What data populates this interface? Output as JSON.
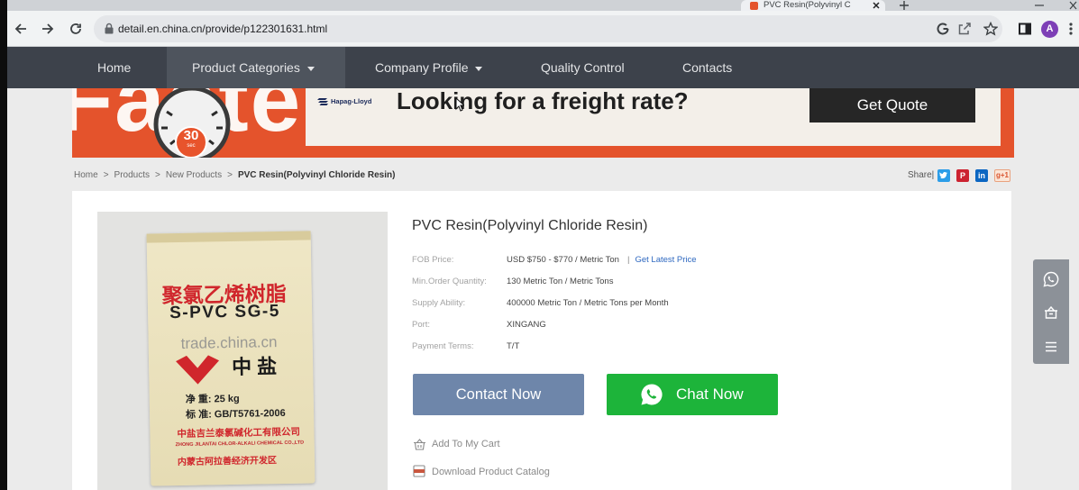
{
  "browser": {
    "tab_title": "PVC Resin(Polyvinyl C",
    "url": "detail.en.china.cn/provide/p122301631.html",
    "avatar_letter": "A"
  },
  "nav": {
    "items": [
      {
        "label": "Home"
      },
      {
        "label": "Product Categories",
        "has_dropdown": true,
        "active": true
      },
      {
        "label": "Company Profile",
        "has_dropdown": true
      },
      {
        "label": "Quality Control"
      },
      {
        "label": "Contacts"
      }
    ]
  },
  "banner": {
    "headline_fragment": "Faster",
    "timer_number": "30",
    "timer_unit": "sec",
    "brand": "Hapag-Lloyd",
    "headline": "Looking for a freight rate?",
    "cta": "Get Quote"
  },
  "breadcrumb": {
    "separator": ">",
    "items": [
      "Home",
      "Products",
      "New Products"
    ],
    "current": "PVC Resin(Polyvinyl Chloride Resin)"
  },
  "share": {
    "label": "Share|",
    "pinterest_logo": "P",
    "linkedin_logo": "in",
    "gplus_logo": "g+1"
  },
  "product": {
    "title": "PVC Resin(Polyvinyl Chloride Resin)",
    "specs": [
      {
        "label": "FOB Price:",
        "value": "USD $750 - $770 / Metric Ton"
      },
      {
        "label": "Min.Order Quantity:",
        "value": "130 Metric Ton / Metric Tons"
      },
      {
        "label": "Supply Ability:",
        "value": "400000 Metric Ton / Metric Tons per Month"
      },
      {
        "label": "Port:",
        "value": "XINGANG"
      },
      {
        "label": "Payment Terms:",
        "value": "T/T"
      }
    ],
    "price_separator": "|",
    "price_link": "Get Latest Price",
    "contact_button": "Contact Now",
    "chat_button": "Chat Now",
    "add_to_cart": "Add To My Cart",
    "download_catalog": "Download Product Catalog",
    "image": {
      "name_cn": "聚氯乙烯树脂",
      "grade": "S-PVC SG-5",
      "watermark": "trade.china.cn",
      "brand_cn": "中盐",
      "net_weight": "净 重: 25 kg",
      "standard": "标 准: GB/T5761-2006",
      "company_cn": "中盐吉兰泰氯碱化工有限公司",
      "company_en": "ZHONG JILANTAI CHLOR-ALKALI CHEMICAL CO.,LTD",
      "address_cn": "内蒙古阿拉善经济开发区"
    }
  },
  "icons": {
    "browser": [
      "arrow-left-icon",
      "arrow-right-icon",
      "reload-icon",
      "lock-icon",
      "google-icon",
      "share-icon",
      "star-icon",
      "side-panel-icon",
      "menu-dots-icon"
    ],
    "share": [
      "twitter-icon",
      "pinterest-icon",
      "linkedin-icon",
      "google-plus-icon"
    ],
    "actions": [
      "whatsapp-icon",
      "cart-icon",
      "pdf-icon"
    ],
    "toolbar": [
      "whatsapp-icon",
      "shop-icon",
      "hamburger-menu-icon"
    ]
  },
  "colors": {
    "nav_bg": "#3d424b",
    "banner_orange": "#e4532c",
    "contact_button": "#6e86aa",
    "chat_button": "#1db43a",
    "link": "#2e68c0",
    "toolbar": "#8c9198"
  }
}
